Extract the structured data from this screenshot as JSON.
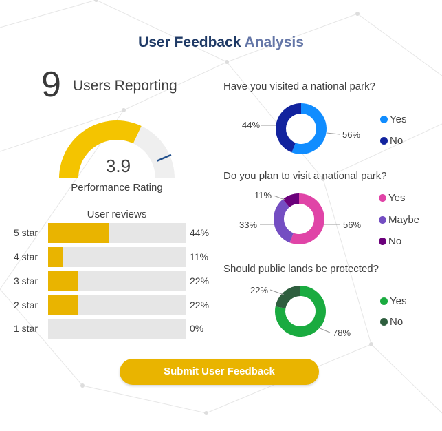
{
  "title": {
    "part1": "User Feedback",
    "part2": "Analysis"
  },
  "users": {
    "count": "9",
    "label": "Users Reporting"
  },
  "rating": {
    "value": "3.9",
    "label": "Performance Rating",
    "fraction": 0.78,
    "gauge_color": "#f4c400",
    "track_color": "#efefef",
    "marker_color": "#1f4e8c"
  },
  "reviews": {
    "title": "User reviews",
    "fill_color": "#e9b400",
    "rows": [
      {
        "label": "5 star",
        "pct_text": "44%",
        "value": 44
      },
      {
        "label": "4 star",
        "pct_text": "11%",
        "value": 11
      },
      {
        "label": "3 star",
        "pct_text": "22%",
        "value": 22
      },
      {
        "label": "2 star",
        "pct_text": "22%",
        "value": 22
      },
      {
        "label": "1 star",
        "pct_text": "0%",
        "value": 0
      }
    ]
  },
  "questions": [
    {
      "title": "Have you visited a national park?",
      "segments": [
        {
          "label": "Yes",
          "value": 56,
          "pct_text": "56%",
          "color": "#118dff"
        },
        {
          "label": "No",
          "value": 44,
          "pct_text": "44%",
          "color": "#12239e"
        }
      ]
    },
    {
      "title": "Do you plan to visit a national park?",
      "segments": [
        {
          "label": "Yes",
          "value": 56,
          "pct_text": "56%",
          "color": "#e044a7"
        },
        {
          "label": "Maybe",
          "value": 33,
          "pct_text": "33%",
          "color": "#744ec2"
        },
        {
          "label": "No",
          "value": 11,
          "pct_text": "11%",
          "color": "#6b007b"
        }
      ]
    },
    {
      "title": "Should public lands be protected?",
      "segments": [
        {
          "label": "Yes",
          "value": 78,
          "pct_text": "78%",
          "color": "#1aab40"
        },
        {
          "label": "No",
          "value": 22,
          "pct_text": "22%",
          "color": "#2e5e3e"
        }
      ]
    }
  ],
  "submit": {
    "label": "Submit User Feedback"
  }
}
